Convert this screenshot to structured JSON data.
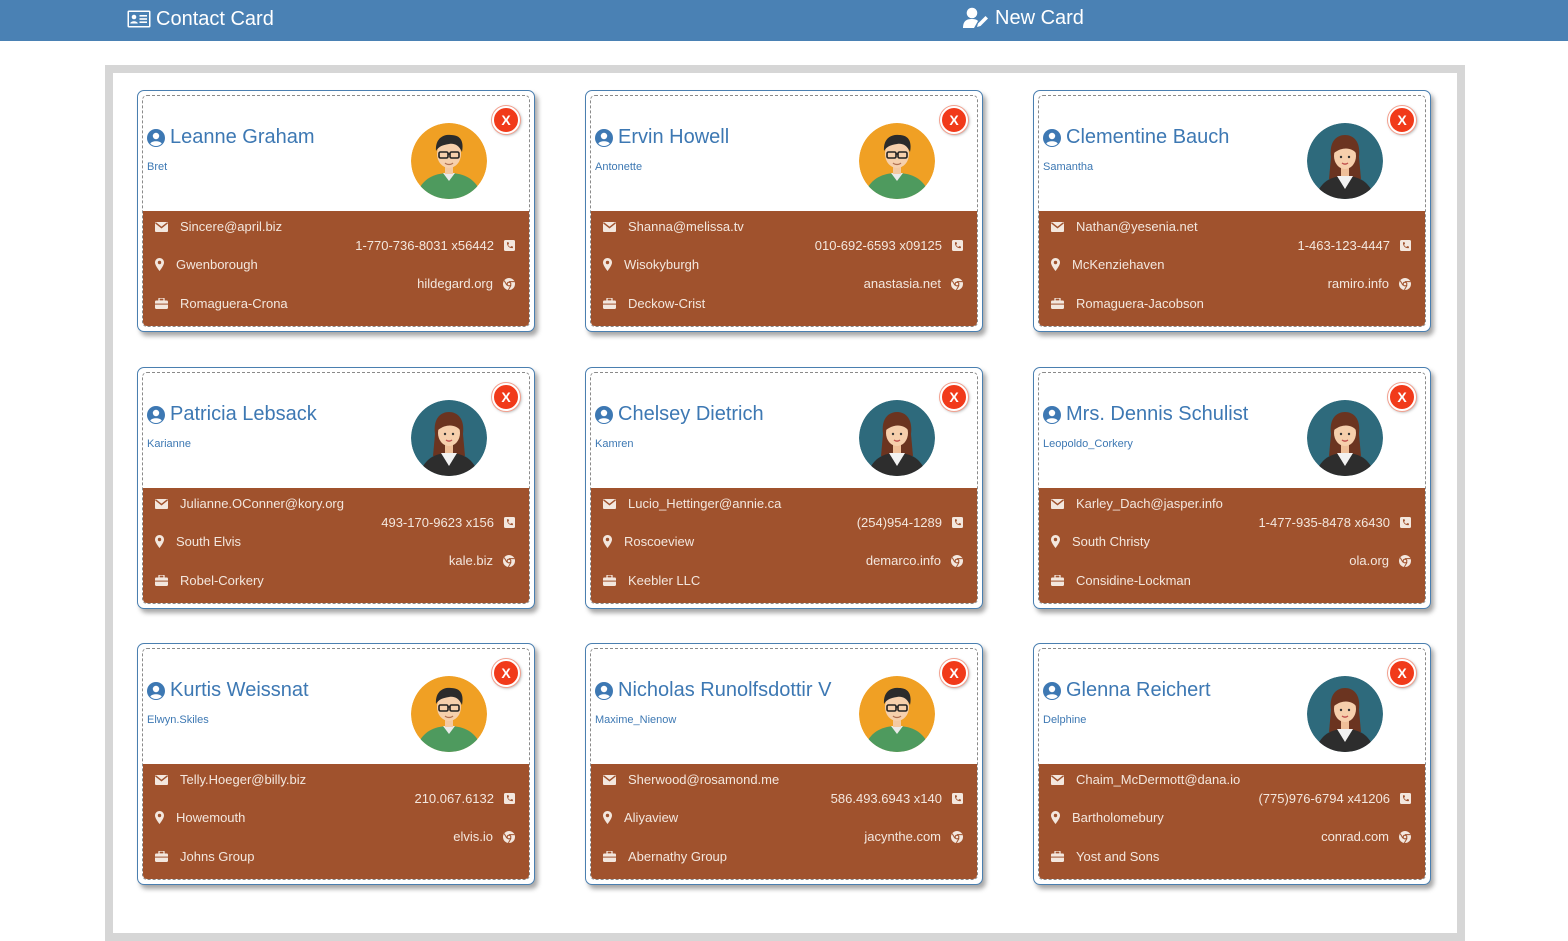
{
  "nav": {
    "brand_label": "Contact Card",
    "new_card_label": "New Card"
  },
  "colors": {
    "header": "#4a81b4",
    "info_panel": "#a0522d",
    "name_text": "#3d78b3",
    "close_button": "#f13a1a"
  },
  "close_label": "X",
  "cards": [
    {
      "name": "Leanne Graham",
      "username": "Bret",
      "email": "Sincere@april.biz",
      "phone": "1-770-736-8031 x56442",
      "city": "Gwenborough",
      "website": "hildegard.org",
      "company": "Romaguera-Crona",
      "avatar": "male-avatar"
    },
    {
      "name": "Ervin Howell",
      "username": "Antonette",
      "email": "Shanna@melissa.tv",
      "phone": "010-692-6593 x09125",
      "city": "Wisokyburgh",
      "website": "anastasia.net",
      "company": "Deckow-Crist",
      "avatar": "male-avatar"
    },
    {
      "name": "Clementine Bauch",
      "username": "Samantha",
      "email": "Nathan@yesenia.net",
      "phone": "1-463-123-4447",
      "city": "McKenziehaven",
      "website": "ramiro.info",
      "company": "Romaguera-Jacobson",
      "avatar": "female-avatar"
    },
    {
      "name": "Patricia Lebsack",
      "username": "Karianne",
      "email": "Julianne.OConner@kory.org",
      "phone": "493-170-9623 x156",
      "city": "South Elvis",
      "website": "kale.biz",
      "company": "Robel-Corkery",
      "avatar": "female-avatar"
    },
    {
      "name": "Chelsey Dietrich",
      "username": "Kamren",
      "email": "Lucio_Hettinger@annie.ca",
      "phone": "(254)954-1289",
      "city": "Roscoeview",
      "website": "demarco.info",
      "company": "Keebler LLC",
      "avatar": "female-avatar"
    },
    {
      "name": "Mrs. Dennis Schulist",
      "username": "Leopoldo_Corkery",
      "email": "Karley_Dach@jasper.info",
      "phone": "1-477-935-8478 x6430",
      "city": "South Christy",
      "website": "ola.org",
      "company": "Considine-Lockman",
      "avatar": "female-avatar"
    },
    {
      "name": "Kurtis Weissnat",
      "username": "Elwyn.Skiles",
      "email": "Telly.Hoeger@billy.biz",
      "phone": "210.067.6132",
      "city": "Howemouth",
      "website": "elvis.io",
      "company": "Johns Group",
      "avatar": "male-avatar"
    },
    {
      "name": "Nicholas Runolfsdottir V",
      "username": "Maxime_Nienow",
      "email": "Sherwood@rosamond.me",
      "phone": "586.493.6943 x140",
      "city": "Aliyaview",
      "website": "jacynthe.com",
      "company": "Abernathy Group",
      "avatar": "male-avatar"
    },
    {
      "name": "Glenna Reichert",
      "username": "Delphine",
      "email": "Chaim_McDermott@dana.io",
      "phone": "(775)976-6794 x41206",
      "city": "Bartholomebury",
      "website": "conrad.com",
      "company": "Yost and Sons",
      "avatar": "female-avatar"
    }
  ]
}
